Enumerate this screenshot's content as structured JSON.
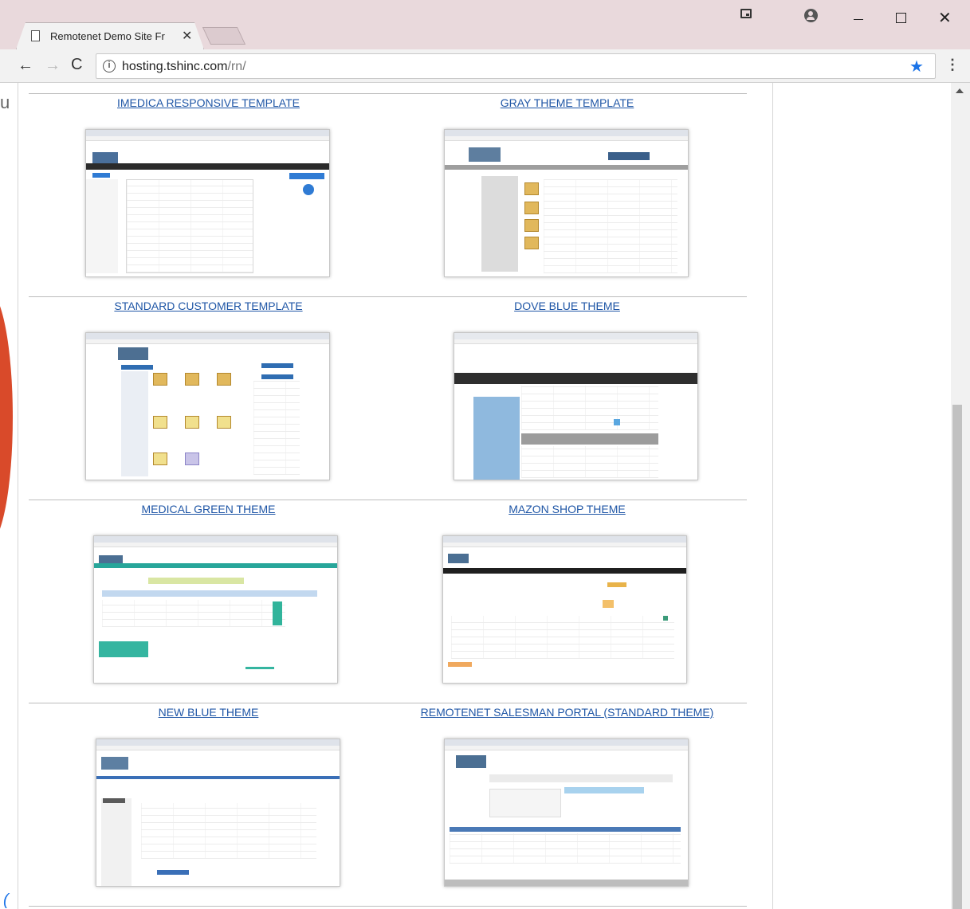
{
  "browser": {
    "tab_title": "Remotenet Demo Site Fr",
    "url_host": "hosting.tshinc.com",
    "url_path": "/rn/"
  },
  "page": {
    "left_cut_text": "u",
    "templates": [
      {
        "title": "IMEDICA RESPONSIVE TEMPLATE"
      },
      {
        "title": "GRAY THEME TEMPLATE"
      },
      {
        "title": "STANDARD CUSTOMER TEMPLATE"
      },
      {
        "title": "DOVE BLUE THEME"
      },
      {
        "title": "MEDICAL GREEN THEME"
      },
      {
        "title": "MAZON SHOP THEME"
      },
      {
        "title": "NEW BLUE THEME"
      },
      {
        "title": "REMOTENET SALESMAN PORTAL (STANDARD THEME)"
      }
    ]
  },
  "colors": {
    "link": "#1f56a6",
    "titlebar": "#e9d9dc",
    "bookmark_star": "#1a73e8"
  }
}
